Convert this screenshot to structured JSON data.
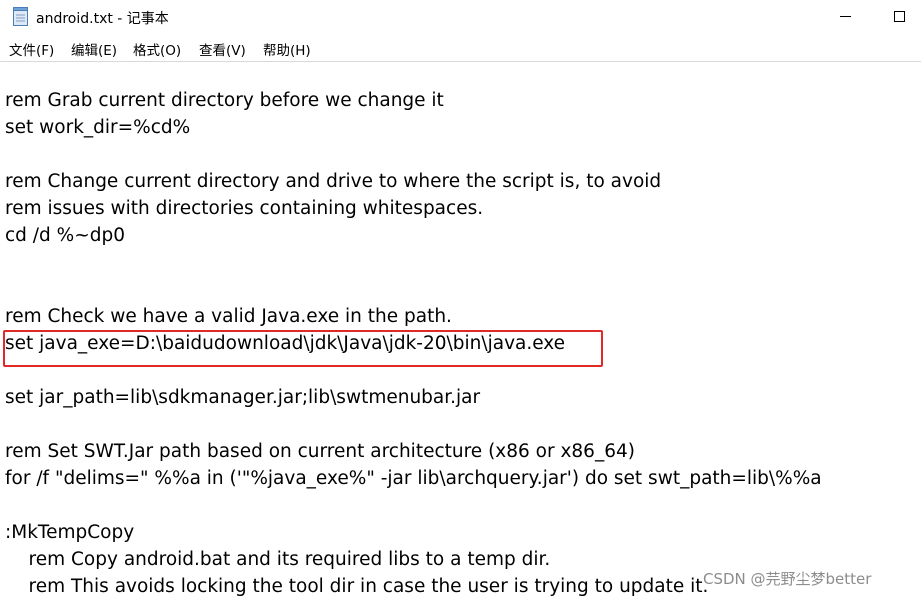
{
  "window": {
    "title": "android.txt - 记事本"
  },
  "menu": {
    "items": [
      {
        "label": "文件(F)"
      },
      {
        "label": "编辑(E)"
      },
      {
        "label": "格式(O)"
      },
      {
        "label": "查看(V)"
      },
      {
        "label": "帮助(H)"
      }
    ]
  },
  "editor": {
    "lines": [
      "",
      "rem Grab current directory before we change it",
      "set work_dir=%cd%",
      "",
      "rem Change current directory and drive to where the script is, to avoid",
      "rem issues with directories containing whitespaces.",
      "cd /d %~dp0",
      "",
      "",
      "rem Check we have a valid Java.exe in the path.",
      "set java_exe=D:\\baidudownload\\jdk\\Java\\jdk-20\\bin\\java.exe",
      "",
      "set jar_path=lib\\sdkmanager.jar;lib\\swtmenubar.jar",
      "",
      "rem Set SWT.Jar path based on current architecture (x86 or x86_64)",
      "for /f \"delims=\" %%a in ('\"%java_exe%\" -jar lib\\archquery.jar') do set swt_path=lib\\%%a",
      "",
      ":MkTempCopy",
      "    rem Copy android.bat and its required libs to a temp dir.",
      "    rem This avoids locking the tool dir in case the user is trying to update it."
    ]
  },
  "annotation": {
    "highlight_color": "#e02a2a"
  },
  "watermark": {
    "text": "CSDN @芫野尘梦better"
  }
}
